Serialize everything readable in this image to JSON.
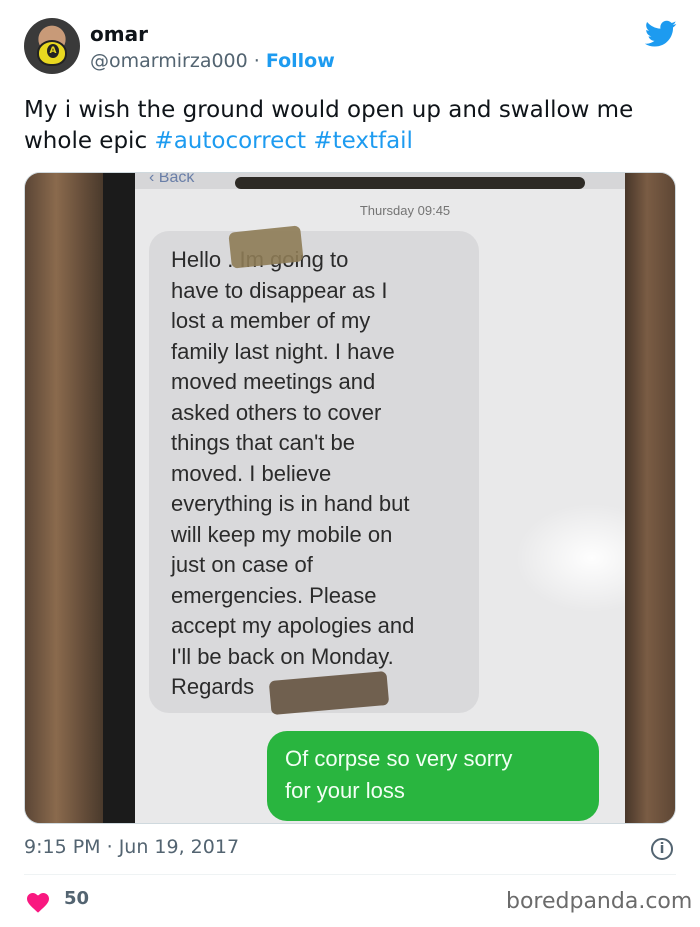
{
  "author": {
    "name": "omar",
    "handle": "@omarmirza000",
    "separator": "·",
    "follow_label": "Follow",
    "avatar_mask_letter": "A"
  },
  "tweet": {
    "text": "My i wish the ground would open up and swallow me whole epic",
    "hashtags": [
      "#autocorrect",
      "#textfail"
    ],
    "time": "9:15 PM",
    "dot": "·",
    "date": "Jun 19, 2017",
    "likes": "50"
  },
  "photo": {
    "back_label": "Back",
    "timestamp": "Thursday 09:45",
    "incoming_message": "Hello        . Im going to\nhave to disappear as I\nlost a member of my\nfamily last night. I have\nmoved meetings and\nasked others to cover\nthings that can't be\nmoved. I believe\neverything is in hand but\nwill keep my mobile on\njust on case of\nemergencies. Please\naccept my apologies and\nI'll be back on Monday.\nRegards",
    "outgoing_message": "Of corpse so very sorry\nfor your loss"
  },
  "icons": {
    "brand": "twitter-bird-icon",
    "info": "info-icon",
    "like": "heart-icon"
  },
  "colors": {
    "accent": "#1d9bf0",
    "heart": "#f91880",
    "muted": "#536471",
    "imessage_green": "#29b53f"
  },
  "watermark": "boredpanda.com"
}
